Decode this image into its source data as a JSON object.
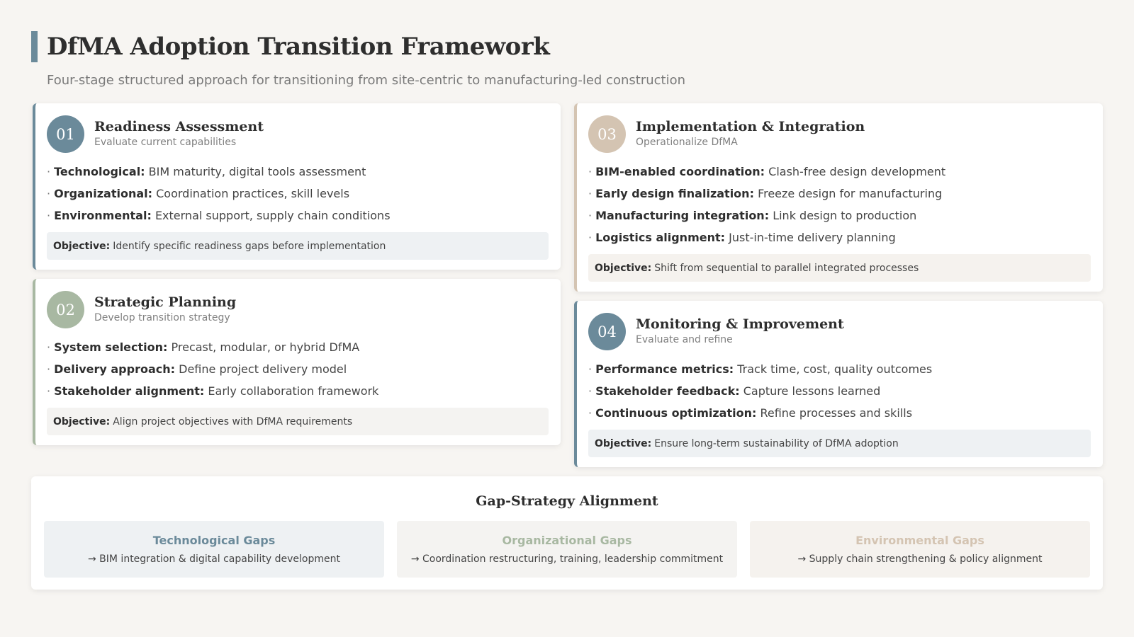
{
  "header": {
    "title": "DfMA Adoption Transition Framework",
    "subtitle": "Four-stage structured approach for transitioning from site-centric to manufacturing-led construction"
  },
  "colors": {
    "accent_blue": "#6b8a9a",
    "accent_sage": "#a8b8a2",
    "accent_tan": "#d4c4b2"
  },
  "stages": [
    {
      "number": "01",
      "title": "Readiness Assessment",
      "subtitle": "Evaluate current capabilities",
      "bullets": [
        {
          "label": "Technological:",
          "text": "BIM maturity, digital tools assessment"
        },
        {
          "label": "Organizational:",
          "text": "Coordination practices, skill levels"
        },
        {
          "label": "Environmental:",
          "text": "External support, supply chain conditions"
        }
      ],
      "objective_label": "Objective:",
      "objective": "Identify specific readiness gaps before implementation"
    },
    {
      "number": "02",
      "title": "Strategic Planning",
      "subtitle": "Develop transition strategy",
      "bullets": [
        {
          "label": "System selection:",
          "text": "Precast, modular, or hybrid DfMA"
        },
        {
          "label": "Delivery approach:",
          "text": "Define project delivery model"
        },
        {
          "label": "Stakeholder alignment:",
          "text": "Early collaboration framework"
        }
      ],
      "objective_label": "Objective:",
      "objective": "Align project objectives with DfMA requirements"
    },
    {
      "number": "03",
      "title": "Implementation & Integration",
      "subtitle": "Operationalize DfMA",
      "bullets": [
        {
          "label": "BIM-enabled coordination:",
          "text": "Clash-free design development"
        },
        {
          "label": "Early design finalization:",
          "text": "Freeze design for manufacturing"
        },
        {
          "label": "Manufacturing integration:",
          "text": "Link design to production"
        },
        {
          "label": "Logistics alignment:",
          "text": "Just-in-time delivery planning"
        }
      ],
      "objective_label": "Objective:",
      "objective": "Shift from sequential to parallel integrated processes"
    },
    {
      "number": "04",
      "title": "Monitoring & Improvement",
      "subtitle": "Evaluate and refine",
      "bullets": [
        {
          "label": "Performance metrics:",
          "text": "Track time, cost, quality outcomes"
        },
        {
          "label": "Stakeholder feedback:",
          "text": "Capture lessons learned"
        },
        {
          "label": "Continuous optimization:",
          "text": "Refine processes and skills"
        }
      ],
      "objective_label": "Objective:",
      "objective": "Ensure long-term sustainability of DfMA adoption"
    }
  ],
  "alignment": {
    "title": "Gap-Strategy Alignment",
    "gaps": [
      {
        "name": "Technological Gaps",
        "desc": "→ BIM integration & digital capability development"
      },
      {
        "name": "Organizational Gaps",
        "desc": "→ Coordination restructuring, training, leadership commitment"
      },
      {
        "name": "Environmental Gaps",
        "desc": "→ Supply chain strengthening & policy alignment"
      }
    ]
  }
}
